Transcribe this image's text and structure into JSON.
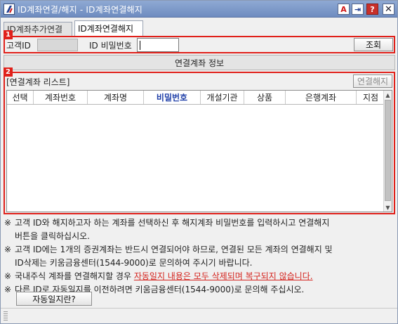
{
  "window": {
    "title": "ID계좌연결/해지 - ID계좌연결해지",
    "titlebar_buttons": {
      "font": "A",
      "pin": "⇥",
      "help": "?",
      "close": "✕"
    }
  },
  "tabs": [
    {
      "label": "ID계좌추가연결",
      "active": false
    },
    {
      "label": "ID계좌연결해지",
      "active": true
    }
  ],
  "markers": {
    "m1": "1",
    "m2": "2"
  },
  "search": {
    "customer_id_label": "고객ID",
    "customer_id_value": "",
    "password_label": "ID 비밀번호",
    "password_value": "",
    "query_button": "조회"
  },
  "info_bar": {
    "label": "연결계좌 정보"
  },
  "list": {
    "title": "[연결계좌 리스트]",
    "unlink_button": "연결해지",
    "columns": [
      "선택",
      "계좌번호",
      "계좌명",
      "비밀번호",
      "개설기관",
      "상품",
      "은행계좌",
      "지점"
    ],
    "rows": []
  },
  "notes": {
    "mark": "※",
    "n1": "고객 ID와 해지하고자 하는 계좌를 선택하신 후 해지계좌 비밀번호를 입력하시고 연결해지",
    "n1b": "버튼을 클릭하십시오.",
    "n2": "고객 ID에는 1개의 증권계좌는 반드시 연결되어야 하므로, 연결된 모든 계좌의 연결해지 및",
    "n2b": "ID삭제는 키움금융센터(1544-9000)로 문의하여 주시기 바랍니다.",
    "n3_prefix": "국내주식 계좌를 연결해지할 경우 ",
    "n3_warning": "자동일지 내용은 모두 삭제되며 복구되지 않습니다.",
    "n4": "다른 ID로 자동일지를 이전하려면 키움금융센터(1544-9000)로 문의해 주십시오."
  },
  "help_button": "자동일지란?",
  "colors": {
    "accent_red": "#e0201a",
    "header_accent": "#1f3fa8",
    "titlebar": "#7f9bca"
  }
}
